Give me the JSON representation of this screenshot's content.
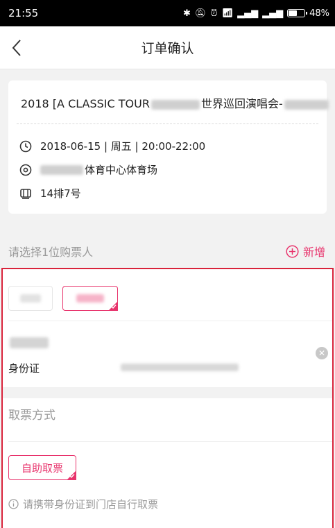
{
  "status_bar": {
    "time": "21:55",
    "battery": "48%",
    "battery_level": 0.48
  },
  "nav": {
    "title": "订单确认"
  },
  "event": {
    "title_prefix": "2018 [A CLASSIC TOUR",
    "title_suffix": "世界巡回演唱会-",
    "datetime": "2018-06-15 | 周五 | 20:00-22:00",
    "venue_suffix": "体育中心体育场",
    "seat": "14排7号"
  },
  "buyer": {
    "prompt": "请选择1位购票人",
    "add_label": "新增",
    "id_type": "身份证"
  },
  "pickup": {
    "label": "取票方式",
    "method": "自助取票",
    "tip": "请携带身份证到门店自行取票"
  },
  "colors": {
    "accent": "#e8336c",
    "highlight_border": "#d9233b"
  }
}
